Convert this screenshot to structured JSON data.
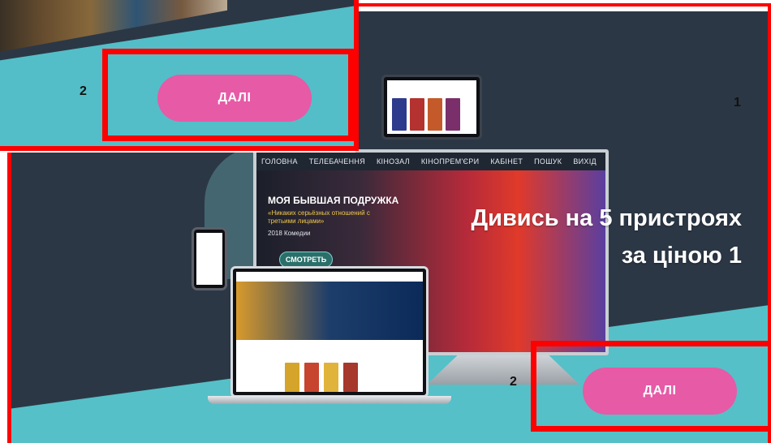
{
  "annotations": {
    "one": "1",
    "two": "2"
  },
  "inset": {
    "button_label": "ДАЛІ"
  },
  "main": {
    "headline_line1": "Дивись на 5 пристроях",
    "headline_line2": "за ціною 1",
    "button_label": "ДАЛІ",
    "tv": {
      "nav": [
        "ГОЛОВНА",
        "ТЕЛЕБАЧЕННЯ",
        "КІНОЗАЛ",
        "КІНОПРЕМ'ЄРИ",
        "КАБІНЕТ",
        "ПОШУК",
        "ВИХІД"
      ],
      "movie_title": "МОЯ БЫВШАЯ ПОДРУЖКА",
      "tagline": "«Никаких серьёзных отношений с третьими лицами»",
      "meta": "2018   Комедии",
      "watch_button": "СМОТРЕТЬ"
    }
  },
  "colors": {
    "dark": "#2c3745",
    "teal": "#55c0c8",
    "button": "#e65aa6",
    "highlight": "#ff0000"
  }
}
